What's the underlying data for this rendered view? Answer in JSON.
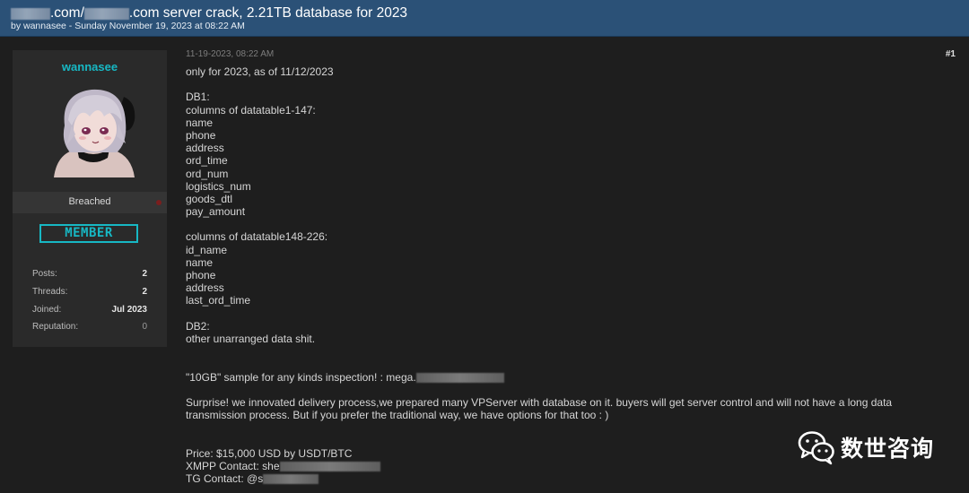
{
  "header": {
    "title_part1": ".com/",
    "title_part2": ".com server crack, 2.21TB database for 2023",
    "byline": "by wannasee - Sunday November 19, 2023 at 08:22 AM"
  },
  "author": {
    "username": "wannasee",
    "rank": "Breached",
    "badge": "MEMBER",
    "stats": [
      {
        "label": "Posts:",
        "value": "2"
      },
      {
        "label": "Threads:",
        "value": "2"
      },
      {
        "label": "Joined:",
        "value": "Jul 2023"
      },
      {
        "label": "Reputation:",
        "value": "0"
      }
    ]
  },
  "post": {
    "date": "11-19-2023, 08:22 AM",
    "number": "#1",
    "lines": {
      "intro": "only for 2023, as of 11/12/2023",
      "db1_header": "DB1:",
      "db1_cols_header": "columns of datatable1-147:",
      "db1_cols": [
        "name",
        "phone",
        "address",
        "ord_time",
        "ord_num",
        "logistics_num",
        "goods_dtl",
        "pay_amount"
      ],
      "db2_cols_header": "columns of datatable148-226:",
      "db2_cols": [
        "id_name",
        "name",
        "phone",
        "address",
        "last_ord_time"
      ],
      "db2_header": "DB2:",
      "db2_desc": "other unarranged data shit.",
      "sample": "\"10GB\" sample for any kinds inspection! : mega.",
      "surprise": "Surprise! we innovated delivery process,we prepared many VPServer with database on it. buyers will get server control and will not have a long data transmission process. But if you prefer the traditional way, we have options for that too : )",
      "price": "Price: $15,000 USD  by  USDT/BTC",
      "xmpp": "XMPP Contact: she",
      "tg": "TG Contact: @s"
    }
  },
  "watermark": {
    "text": "数世咨询",
    "icon": "wechat-icon"
  }
}
